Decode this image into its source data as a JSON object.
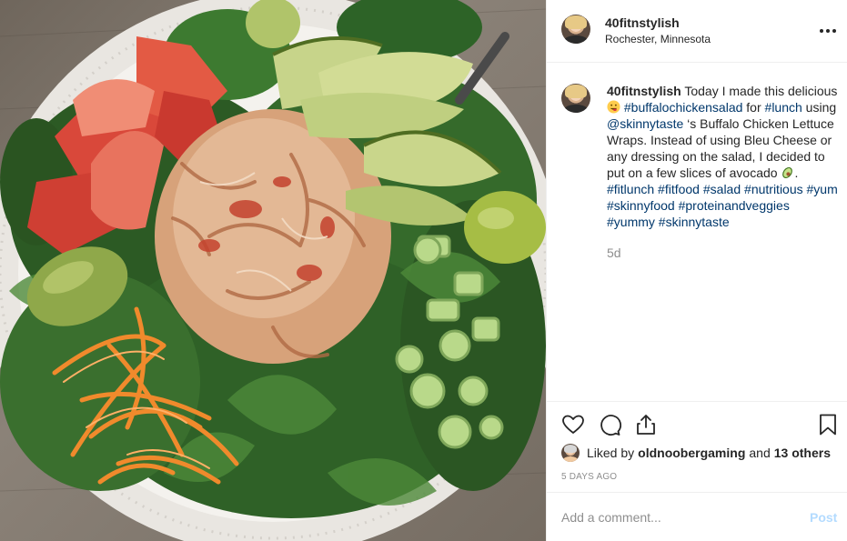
{
  "header": {
    "username": "40fitnstylish",
    "location": "Rochester, Minnesota"
  },
  "caption": {
    "username": "40fitnstylish",
    "segments": [
      {
        "type": "text",
        "value": " Today I made this delicious "
      },
      {
        "type": "emoji",
        "name": "yum-face-emoji"
      },
      {
        "type": "text",
        "value": " "
      },
      {
        "type": "tag",
        "value": "#buffalochickensalad"
      },
      {
        "type": "text",
        "value": " for "
      },
      {
        "type": "tag",
        "value": "#lunch"
      },
      {
        "type": "text",
        "value": " using "
      },
      {
        "type": "tag",
        "value": "@skinnytaste"
      },
      {
        "type": "text",
        "value": " ‘s Buffalo Chicken Lettuce Wraps. Instead of using Bleu Cheese or any dressing on the salad, I decided to put on a few slices of avocado "
      },
      {
        "type": "emoji",
        "name": "avocado-emoji"
      },
      {
        "type": "text",
        "value": ". "
      },
      {
        "type": "tag",
        "value": "#fitlunch"
      },
      {
        "type": "text",
        "value": " "
      },
      {
        "type": "tag",
        "value": "#fitfood"
      },
      {
        "type": "text",
        "value": " "
      },
      {
        "type": "tag",
        "value": "#salad"
      },
      {
        "type": "text",
        "value": " "
      },
      {
        "type": "tag",
        "value": "#nutritious"
      },
      {
        "type": "text",
        "value": " "
      },
      {
        "type": "tag",
        "value": "#yum"
      },
      {
        "type": "text",
        "value": " "
      },
      {
        "type": "tag",
        "value": "#skinnyfood"
      },
      {
        "type": "text",
        "value": " "
      },
      {
        "type": "tag",
        "value": "#proteinandveggies"
      },
      {
        "type": "text",
        "value": " "
      },
      {
        "type": "tag",
        "value": "#yummy"
      },
      {
        "type": "text",
        "value": " "
      },
      {
        "type": "tag",
        "value": "#skinnytaste"
      }
    ],
    "time_ago": "5d"
  },
  "actions": {
    "icons": [
      "heart-icon",
      "comment-icon",
      "share-icon",
      "bookmark-icon"
    ]
  },
  "likes": {
    "prefix": "Liked by",
    "user": "oldnoobergaming",
    "connector": "and",
    "others": "13 others"
  },
  "date": "5 DAYS AGO",
  "comment": {
    "placeholder": "Add a comment...",
    "post_label": "Post"
  },
  "colors": {
    "hashtag": "#00376b",
    "muted": "#8e8e8e",
    "post_disabled": "#b3dbff",
    "divider": "#efefef"
  },
  "photo": {
    "subject": "buffalo chicken salad with avocado, tomato, carrot, celery, peppers on spinach"
  }
}
